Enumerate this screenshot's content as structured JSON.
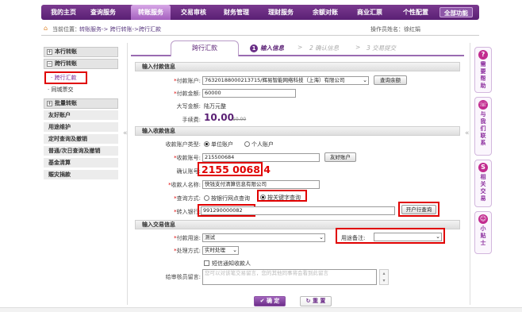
{
  "nav": {
    "items": [
      "我的主页",
      "查询服务",
      "转账服务",
      "交易审核",
      "财务管理",
      "理财服务",
      "余额对账",
      "商业汇票",
      "个性配置"
    ],
    "active_index": 2,
    "all_functions": "全部功能"
  },
  "location": {
    "label": "当前位置：",
    "path": "转账服务-> 跨行转账->跨行汇款",
    "operator": "操作员姓名：徐红娟"
  },
  "sidebar": {
    "sections": [
      {
        "label": "本行转账",
        "toggle": "+"
      },
      {
        "label": "跨行转账",
        "toggle": "−"
      }
    ],
    "subitems": [
      {
        "label": "跨行汇款",
        "selected": true
      },
      {
        "label": "同城票交",
        "selected": false
      }
    ],
    "section3": {
      "label": "批量转账",
      "toggle": "+"
    },
    "items": [
      "友好账户",
      "用途维护",
      "定时查询及撤销",
      "普通/次日查询及撤销",
      "基金清算",
      "赈灾捐款"
    ],
    "collapse_glyph": "«"
  },
  "tabs": {
    "active": "跨行汇款",
    "steps": [
      {
        "num": "1",
        "label": "输入信息",
        "current": true
      },
      {
        "num": "2",
        "label": "确认信息",
        "current": false
      },
      {
        "num": "3",
        "label": "交易提交",
        "current": false
      }
    ],
    "arrow": ">"
  },
  "payer": {
    "section": "输入付款信息",
    "account_label": "付款账户:",
    "account_value": "76320188000213715/辉易智能网络科技（上海）有限公司",
    "balance_button": "查询余额",
    "amount_label": "付款金额:",
    "amount_value": "60000",
    "upper_label": "大写金额:",
    "upper_value": "陆万元整",
    "fee_label": "手续费:",
    "fee_value": "10.00",
    "fee_old": "10.00"
  },
  "payee": {
    "section": "输入收款信息",
    "type_label": "收款账户类型:",
    "type_options": [
      "单位账户",
      "个人账户"
    ],
    "type_selected": 0,
    "account_label": "收款账号:",
    "account_value": "215500684",
    "friend_button": "友好账户",
    "confirm_label": "确认账号:",
    "confirm_value": "2155 0068 4",
    "name_label": "收款人名称:",
    "name_value": "快钱支付清算信息有限公司",
    "query_label": "查询方式:",
    "query_options": [
      "按银行网点查询",
      "按关键字查询"
    ],
    "query_selected": 1,
    "bank_label": "转入银行:",
    "bank_value": "991290000082",
    "bank_button": "开户行查询"
  },
  "trade": {
    "section": "输入交易信息",
    "purpose_label": "付款用途:",
    "purpose_value": "测试",
    "remark_label": "用途备注:",
    "remark_value": "",
    "process_label": "处理方式:",
    "process_value": "实时处理",
    "sms_label": "短信通知收款人",
    "msg_label": "给审核员留言:",
    "msg_placeholder": "您可以对该笔交易留言，您的其他同事将会看到此留言"
  },
  "actions": {
    "confirm": "确 定",
    "confirm_icon": "✔",
    "reset": "重 置",
    "reset_icon": "↻"
  },
  "right_panel": [
    {
      "icon": "?",
      "label": "需要帮助"
    },
    {
      "icon": "☏",
      "label": "与我们联系"
    },
    {
      "icon": "S",
      "label": "相关交易"
    },
    {
      "icon": "☺",
      "label": "小贴士"
    }
  ],
  "colors": {
    "brand": "#5a1f74",
    "highlight": "#e00000"
  }
}
